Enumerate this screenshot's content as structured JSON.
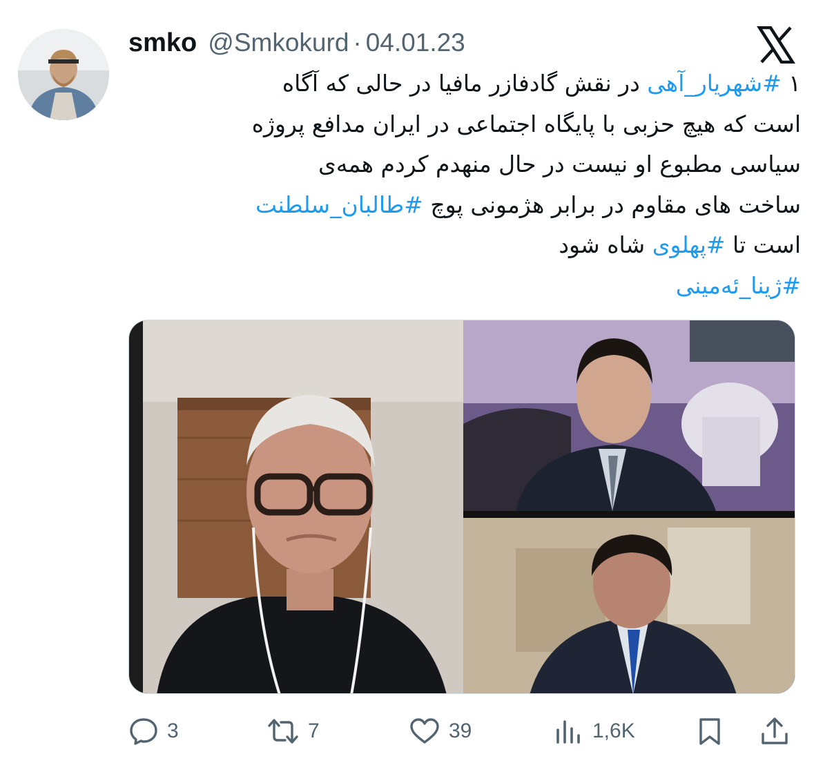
{
  "author": {
    "name": "smko",
    "handle": "@Smkokurd",
    "separator": "·",
    "date": "04.01.23"
  },
  "logo": {
    "icon": "x-logo-icon"
  },
  "tweet": {
    "lines": [
      [
        {
          "text": "١ ",
          "tag": false
        },
        {
          "text": "#شهریار_آهی",
          "tag": true
        },
        {
          "text": " در نقش گادفازر مافیا در حالی که آگاه",
          "tag": false
        }
      ],
      [
        {
          "text": "است که هیچ حزبی با پایگاه اجتماعی در ایران مدافع پروژه",
          "tag": false
        }
      ],
      [
        {
          "text": "سیاسی مطبوع او نیست در حال منهدم کردم همه‌ی",
          "tag": false
        }
      ],
      [
        {
          "text": "ساخت های مقاوم در برابر هژمونی پوچ ",
          "tag": false
        },
        {
          "text": "#طالبان_سلطنت",
          "tag": true
        }
      ],
      [
        {
          "text": "است تا ",
          "tag": false
        },
        {
          "text": "#پهلوی",
          "tag": true
        },
        {
          "text": " شاه شود",
          "tag": false
        }
      ],
      [
        {
          "text": "#ژینا_ئه‌مینی",
          "tag": true
        }
      ]
    ]
  },
  "media": {
    "type": "video-call-screenshot"
  },
  "actions": {
    "reply": {
      "icon": "reply-icon",
      "count": "3"
    },
    "retweet": {
      "icon": "retweet-icon",
      "count": "7"
    },
    "like": {
      "icon": "heart-icon",
      "count": "39"
    },
    "views": {
      "icon": "views-chart-icon",
      "count": "1,6K"
    },
    "bookmark": {
      "icon": "bookmark-icon"
    },
    "share": {
      "icon": "share-icon"
    }
  },
  "colors": {
    "text": "#0f1419",
    "secondary": "#536471",
    "link": "#1d9bf0"
  }
}
